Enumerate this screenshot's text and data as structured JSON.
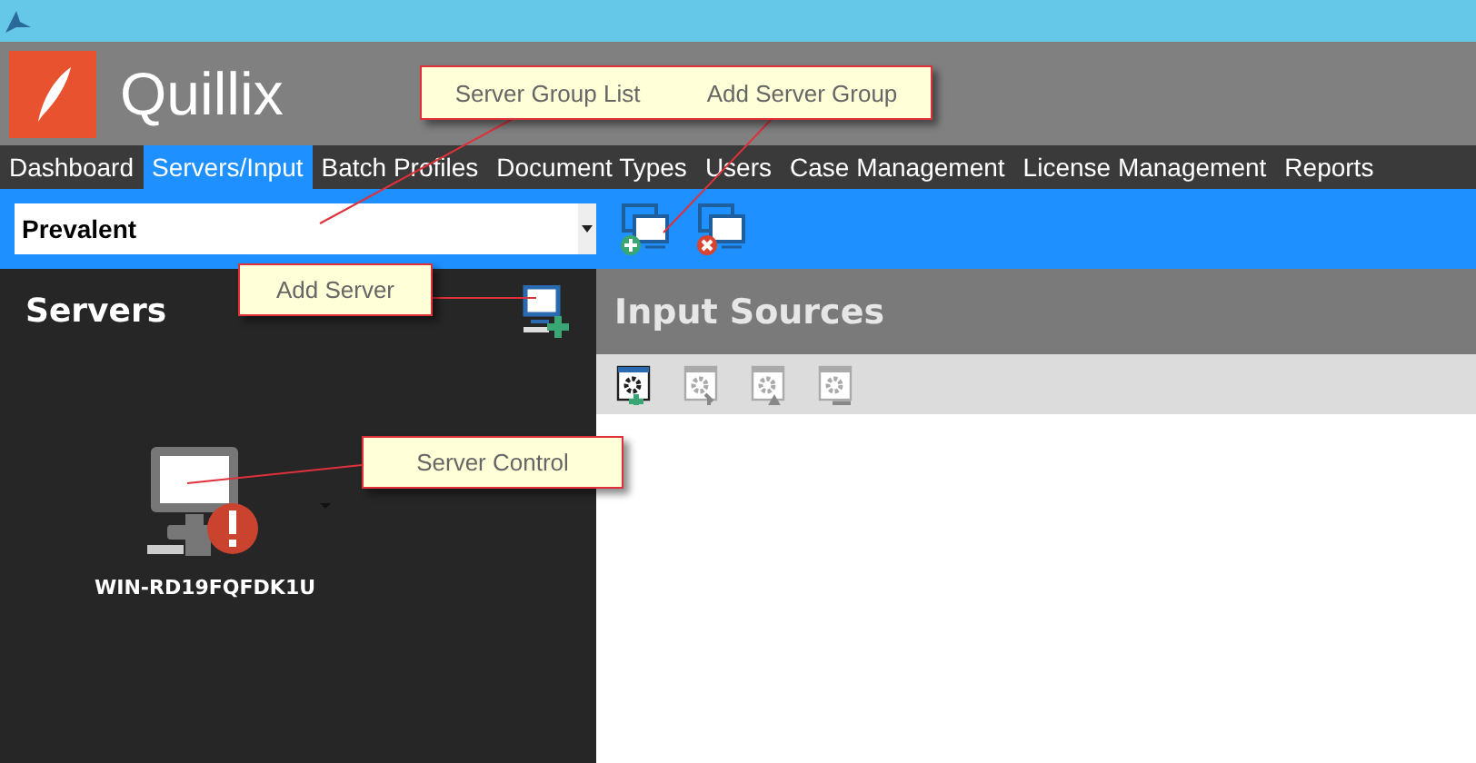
{
  "app": {
    "name": "Quillix"
  },
  "tabs": [
    {
      "label": "Dashboard",
      "selected": false
    },
    {
      "label": "Servers/Input",
      "selected": true
    },
    {
      "label": "Batch Profiles",
      "selected": false
    },
    {
      "label": "Document Types",
      "selected": false
    },
    {
      "label": "Users",
      "selected": false
    },
    {
      "label": "Case Management",
      "selected": false
    },
    {
      "label": "License Management",
      "selected": false
    },
    {
      "label": "Reports",
      "selected": false
    }
  ],
  "server_group": {
    "value": "Prevalent"
  },
  "servers_panel": {
    "title": "Servers",
    "servers": [
      {
        "name": "WIN-RD19FQFDK1U",
        "error": true
      }
    ]
  },
  "input_sources": {
    "title": "Input Sources",
    "tools": [
      {
        "kind": "add",
        "disabled": false
      },
      {
        "kind": "edit",
        "disabled": true
      },
      {
        "kind": "warn",
        "disabled": true
      },
      {
        "kind": "remove",
        "disabled": true
      }
    ]
  },
  "callouts": [
    {
      "texts": [
        "Server Group List",
        "Add Server Group"
      ]
    },
    {
      "texts": [
        "Add Server"
      ]
    },
    {
      "texts": [
        "Server Control"
      ]
    }
  ]
}
